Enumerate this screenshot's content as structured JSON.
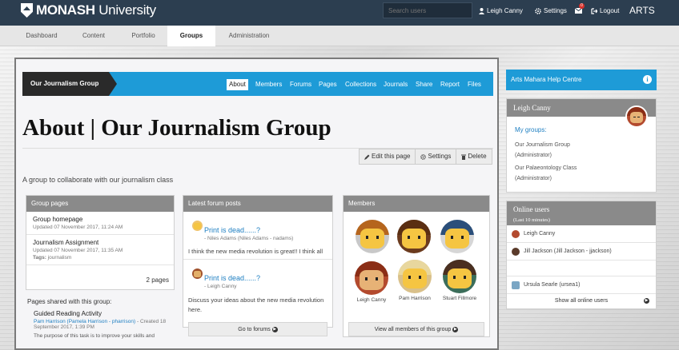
{
  "header": {
    "logo_bold": "MONASH",
    "logo_light": " University",
    "search_placeholder": "Search users",
    "user_name": "Leigh Canny",
    "settings_label": "Settings",
    "notification_count": "0",
    "logout_label": "Logout",
    "institution": "ARTS"
  },
  "nav": {
    "tabs": [
      {
        "label": "Dashboard"
      },
      {
        "label": "Content"
      },
      {
        "label": "Portfolio"
      },
      {
        "label": "Groups",
        "active": true
      },
      {
        "label": "Administration"
      }
    ]
  },
  "group": {
    "name": "Our Journalism Group",
    "tabs": [
      "About",
      "Members",
      "Forums",
      "Pages",
      "Collections",
      "Journals",
      "Share",
      "Report",
      "Files"
    ],
    "active_tab": "About"
  },
  "page": {
    "title": "About | Our Journalism Group",
    "description": "A group to collaborate with our journalism class",
    "actions": {
      "edit": "Edit this page",
      "settings": "Settings",
      "delete": "Delete"
    }
  },
  "group_pages": {
    "heading": "Group pages",
    "items": [
      {
        "title": "Group homepage",
        "meta": "Updated 07 November 2017, 11:24 AM"
      },
      {
        "title": "Journalism Assignment",
        "meta": "Updated 07 November 2017, 11:35 AM",
        "tags_label": "Tags:",
        "tags": "journalism"
      }
    ],
    "count": "2 pages",
    "shared_heading": "Pages shared with this group:",
    "shared": {
      "title": "Guided Reading Activity",
      "author": "Pam Harrison (Pamela Harrison - pharrison)",
      "created": "- Created 18 September 2017, 1:39 PM",
      "excerpt": "The purpose of this task is to improve your skills and"
    }
  },
  "forum": {
    "heading": "Latest forum posts",
    "posts": [
      {
        "title": "Print is dead......?",
        "author": "- Niles Adams (Niles Adams - nadams)",
        "body": "I think the new media revolution is great!! I think all"
      },
      {
        "title": "Print is dead......?",
        "author": "- Leigh Canny",
        "body": "Discuss your ideas about the new media revolution here."
      }
    ],
    "footer": "Go to forums"
  },
  "members": {
    "heading": "Members",
    "list": [
      {
        "name": ""
      },
      {
        "name": ""
      },
      {
        "name": ""
      },
      {
        "name": "Leigh Canny"
      },
      {
        "name": "Pam Harrison"
      },
      {
        "name": "Stuart Fillmore"
      }
    ],
    "footer": "View all members of this group"
  },
  "sidebar": {
    "help": "Arts Mahara Help Centre",
    "profile": {
      "name": "Leigh Canny",
      "my_groups": "My groups:",
      "groups": [
        {
          "name": "Our Journalism Group",
          "role": "(Administrator)"
        },
        {
          "name": "Our Palaeontology Class",
          "role": "(Administrator)"
        }
      ]
    },
    "online": {
      "heading": "Online users",
      "subheading": "(Last 10 minutes)",
      "users": [
        {
          "name": "Leigh Canny"
        },
        {
          "name": "Jill Jackson (Jill Jackson - jjackson)"
        },
        {
          "name": "Ursula Searle (ursea1)"
        }
      ],
      "footer": "Show all online users"
    }
  },
  "colors": {
    "topbar": "#2c3e50",
    "accent": "#1e9bd7",
    "panel_header": "#8a8a8a",
    "link": "#1e7fc2"
  }
}
